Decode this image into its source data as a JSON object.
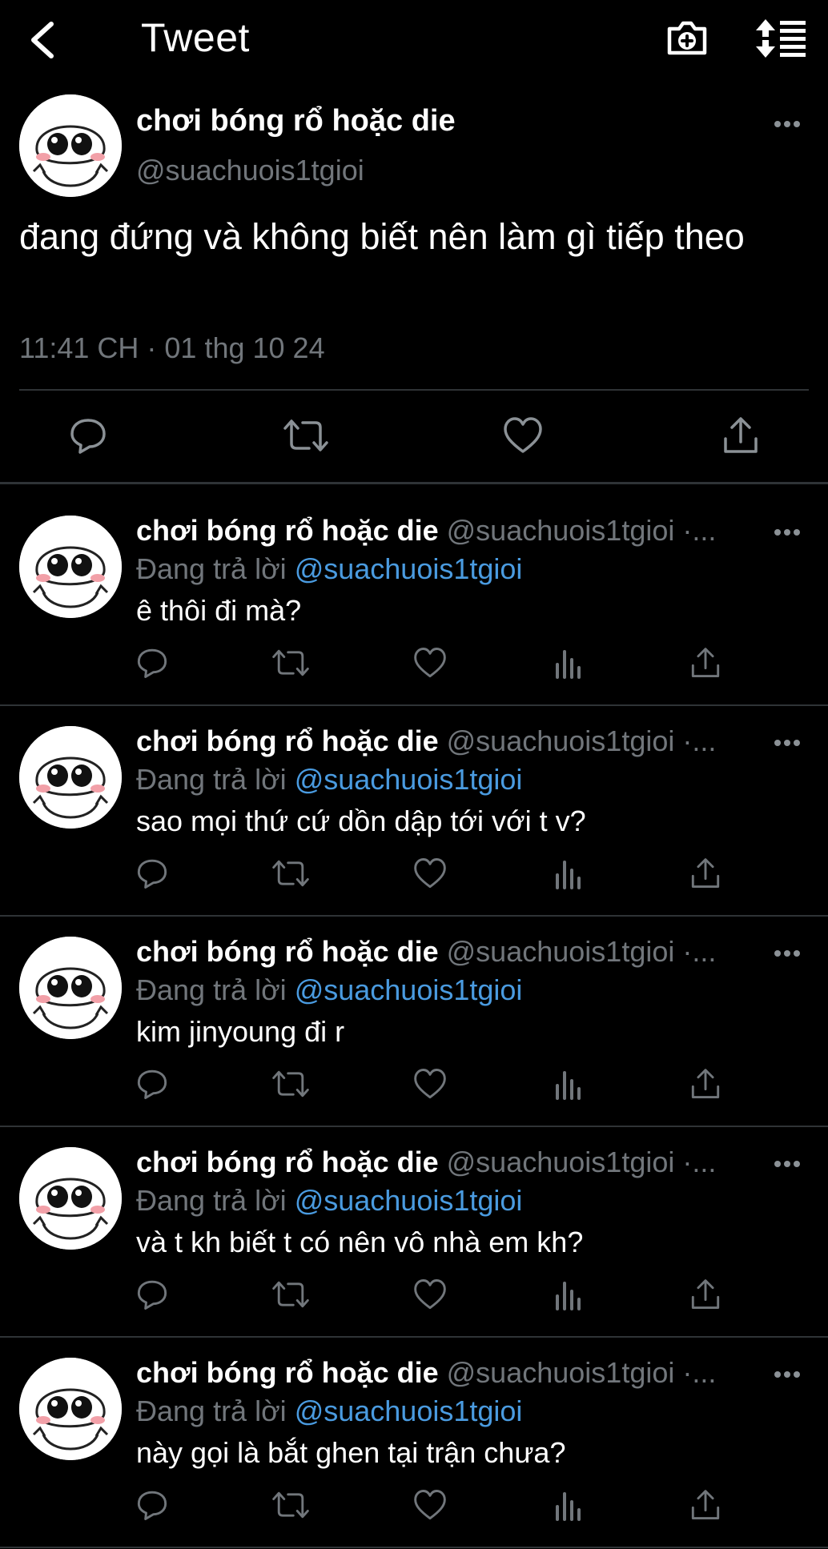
{
  "header": {
    "title": "Tweet",
    "icons": [
      "back-arrow-icon",
      "camera-plus-icon",
      "sort-icon"
    ]
  },
  "main_tweet": {
    "display_name": "chơi bóng rổ hoặc die",
    "handle": "@suachuois1tgioi",
    "text": "đang đứng và không biết nên làm gì tiếp theo",
    "timestamp": "11:41 CH · 01 thg 10 24",
    "actions": [
      "reply-icon",
      "retweet-icon",
      "like-icon",
      "share-icon"
    ]
  },
  "replies": [
    {
      "display_name": "chơi bóng rổ hoặc die",
      "handle": "@suachuois1tgioi ·...",
      "replying_prefix": "Đang trả lời ",
      "replying_to": "@suachuois1tgioi",
      "text": "ê thôi đi mà?"
    },
    {
      "display_name": "chơi bóng rổ hoặc die",
      "handle": "@suachuois1tgioi ·...",
      "replying_prefix": "Đang trả lời ",
      "replying_to": "@suachuois1tgioi",
      "text": "sao mọi thứ cứ dồn dập tới với t v?"
    },
    {
      "display_name": "chơi bóng rổ hoặc die",
      "handle": "@suachuois1tgioi ·...",
      "replying_prefix": "Đang trả lời ",
      "replying_to": "@suachuois1tgioi",
      "text": "kim jinyoung đi r"
    },
    {
      "display_name": "chơi bóng rổ hoặc die",
      "handle": "@suachuois1tgioi ·...",
      "replying_prefix": "Đang trả lời ",
      "replying_to": "@suachuois1tgioi",
      "text": "và t kh biết t có nên vô nhà em kh?"
    },
    {
      "display_name": "chơi bóng rổ hoặc die",
      "handle": "@suachuois1tgioi ·...",
      "replying_prefix": "Đang trả lời ",
      "replying_to": "@suachuois1tgioi",
      "text": "này gọi là bắt ghen tại trận chưa?"
    }
  ],
  "colors": {
    "background": "#000000",
    "text": "#ffffff",
    "muted": "#71767b",
    "mention": "#4a9be0",
    "divider": "#2f3336"
  }
}
